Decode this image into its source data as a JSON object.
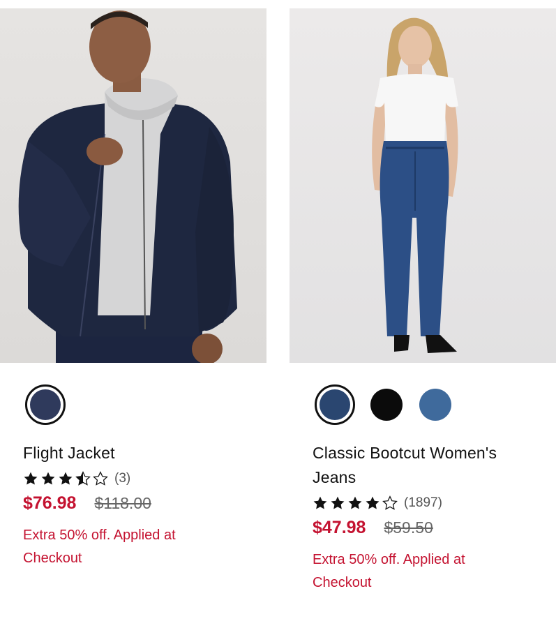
{
  "products": [
    {
      "title": "Flight Jacket",
      "rating_stars": 3.5,
      "review_count": "(3)",
      "sale_price": "$76.98",
      "original_price": "$118.00",
      "promo": "Extra 50% off. Applied at Checkout",
      "swatch_colors": [
        "#2f3a5c"
      ]
    },
    {
      "title": "Classic Bootcut Women's Jeans",
      "rating_stars": 4,
      "review_count": "(1897)",
      "sale_price": "$47.98",
      "original_price": "$59.50",
      "promo": "Extra 50% off. Applied at Checkout",
      "swatch_colors": [
        "#2a4670",
        "#0b0b0b",
        "#3f6a9c"
      ]
    }
  ],
  "colors": {
    "sale": "#c41230",
    "star": "#111111"
  }
}
